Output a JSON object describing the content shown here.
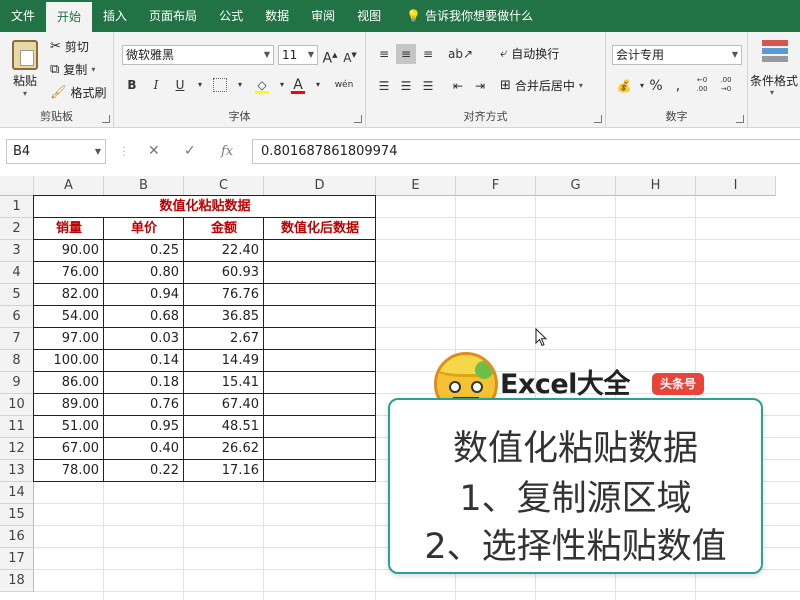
{
  "menu": {
    "tabs": [
      "文件",
      "开始",
      "插入",
      "页面布局",
      "公式",
      "数据",
      "审阅",
      "视图"
    ],
    "active_index": 1,
    "tell_me": "告诉我你想要做什么"
  },
  "ribbon": {
    "clipboard": {
      "label": "剪贴板",
      "paste": "粘贴",
      "cut": "剪切",
      "copy": "复制",
      "format_painter": "格式刷"
    },
    "font": {
      "label": "字体",
      "font_name": "微软雅黑",
      "font_size": "11",
      "bold": "B",
      "italic": "I",
      "underline": "U",
      "phonetic": "wén"
    },
    "alignment": {
      "label": "对齐方式",
      "wrap_text": "自动换行",
      "merge_center": "合并后居中"
    },
    "number": {
      "label": "数字",
      "format": "会计专用",
      "percent": "%"
    },
    "styles": {
      "conditional": "条件格式"
    }
  },
  "formula_bar": {
    "name_box": "B4",
    "formula": "0.801687861809974"
  },
  "sheet": {
    "columns": [
      "A",
      "B",
      "C",
      "D",
      "E",
      "F",
      "G",
      "H",
      "I"
    ],
    "rows": [
      "1",
      "2",
      "3",
      "4",
      "5",
      "6",
      "7",
      "8",
      "9",
      "10",
      "11",
      "12",
      "13",
      "14",
      "15",
      "16",
      "17",
      "18"
    ],
    "title": "数值化粘贴数据",
    "headers": [
      "销量",
      "单价",
      "金额",
      "数值化后数据"
    ],
    "data": [
      [
        "90.00",
        "0.25",
        "22.40"
      ],
      [
        "76.00",
        "0.80",
        "60.93"
      ],
      [
        "82.00",
        "0.94",
        "76.76"
      ],
      [
        "54.00",
        "0.68",
        "36.85"
      ],
      [
        "97.00",
        "0.03",
        "2.67"
      ],
      [
        "100.00",
        "0.14",
        "14.49"
      ],
      [
        "86.00",
        "0.18",
        "15.41"
      ],
      [
        "89.00",
        "0.76",
        "67.40"
      ],
      [
        "51.00",
        "0.95",
        "48.51"
      ],
      [
        "67.00",
        "0.40",
        "26.62"
      ],
      [
        "78.00",
        "0.22",
        "17.16"
      ]
    ]
  },
  "overlay": {
    "brand": "Excel大全",
    "badge": "头条号",
    "line1": "数值化粘贴数据",
    "line2": "1、复制源区域",
    "line3": "2、选择性粘贴数值"
  },
  "colors": {
    "excel_green": "#217346",
    "header_red": "#c00000",
    "card_border": "#2aa198",
    "badge_red": "#e8443a"
  }
}
